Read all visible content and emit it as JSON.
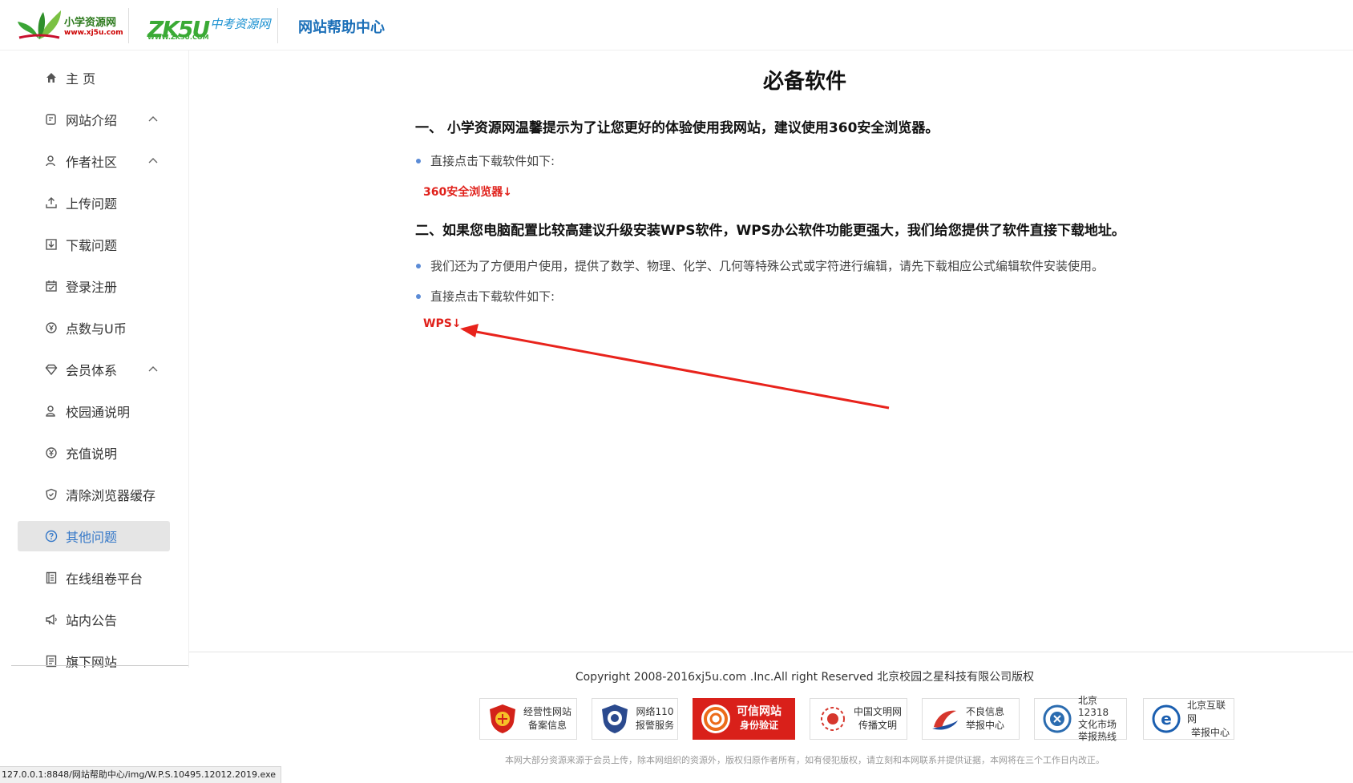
{
  "header": {
    "logo1_name": "小学资源网",
    "logo1_url": "www.xj5u.com",
    "logo2_big": "ZK5U",
    "logo2_cn": "中考资源网",
    "logo2_url": "WWW.ZK5U.COM",
    "help_title": "网站帮助中心"
  },
  "sidebar": {
    "items": [
      {
        "label": "主 页",
        "icon": "home-icon",
        "expandable": false
      },
      {
        "label": "网站介绍",
        "icon": "document-edit-icon",
        "expandable": true
      },
      {
        "label": "作者社区",
        "icon": "user-group-icon",
        "expandable": true
      },
      {
        "label": "上传问题",
        "icon": "upload-icon",
        "expandable": false
      },
      {
        "label": "下载问题",
        "icon": "download-icon",
        "expandable": false
      },
      {
        "label": "登录注册",
        "icon": "calendar-check-icon",
        "expandable": false
      },
      {
        "label": "点数与U币",
        "icon": "coin-icon",
        "expandable": false
      },
      {
        "label": "会员体系",
        "icon": "diamond-icon",
        "expandable": true
      },
      {
        "label": "校园通说明",
        "icon": "user-icon",
        "expandable": false
      },
      {
        "label": "充值说明",
        "icon": "yen-circle-icon",
        "expandable": false
      },
      {
        "label": "清除浏览器缓存",
        "icon": "shield-icon",
        "expandable": false
      },
      {
        "label": "其他问题",
        "icon": "question-circle-icon",
        "expandable": false,
        "active": true
      },
      {
        "label": "在线组卷平台",
        "icon": "book-icon",
        "expandable": false
      },
      {
        "label": "站内公告",
        "icon": "megaphone-icon",
        "expandable": false
      },
      {
        "label": "旗下网站",
        "icon": "list-icon",
        "expandable": false
      }
    ]
  },
  "main": {
    "title": "必备软件",
    "section1": "一、 小学资源网温馨提示为了让您更好的体验使用我网站，建议使用360安全浏览器。",
    "section1_bullet": "直接点击下载软件如下:",
    "section1_link": "360安全浏览器↓",
    "section2": "二、如果您电脑配置比较高建议升级安装WPS软件，WPS办公软件功能更强大，我们给您提供了软件直接下载地址。",
    "section2_bullet1": "我们还为了方便用户使用，提供了数学、物理、化学、几何等特殊公式或字符进行编辑，请先下载相应公式编辑软件安装使用。",
    "section2_bullet2": "直接点击下载软件如下:",
    "section2_link": "WPS↓"
  },
  "footer": {
    "copyright": "Copyright 2008-2016xj5u.com .Inc.All right Reserved 北京校园之星科技有限公司版权",
    "badges": [
      {
        "line1": "经营性网站",
        "line2": "备案信息",
        "icon": "emblem-icon"
      },
      {
        "line1": "网络110",
        "line2": "报警服务",
        "icon": "police-badge-icon"
      },
      {
        "line1": "可信网站",
        "line2": "身份验证",
        "icon": "trusted-site-icon"
      },
      {
        "line1": "中国文明网",
        "line2": "传播文明",
        "icon": "civilization-icon"
      },
      {
        "line1": "不良信息",
        "line2": "举报中心",
        "icon": "report-center-icon"
      },
      {
        "line1": "北京12318",
        "line2": "文化市场",
        "line3": "举报热线",
        "icon": "culture-market-icon"
      },
      {
        "line1": "北京互联网",
        "line2": "举报中心",
        "icon": "beijing-internet-icon"
      }
    ],
    "notice": "本网大部分资源来源于会员上传，除本网组织的资源外，版权归原作者所有，如有侵犯版权，请立刻和本网联系并提供证据，本网将在三个工作日内改正。"
  },
  "statusbar": {
    "url": "127.0.0.1:8848/网站帮助中心/img/W.P.S.10495.12012.2019.exe"
  },
  "colors": {
    "accent": "#3578c8",
    "link_red": "#e0211b",
    "arrow_red": "#e8231c",
    "active_bg": "#e5e5e5"
  }
}
